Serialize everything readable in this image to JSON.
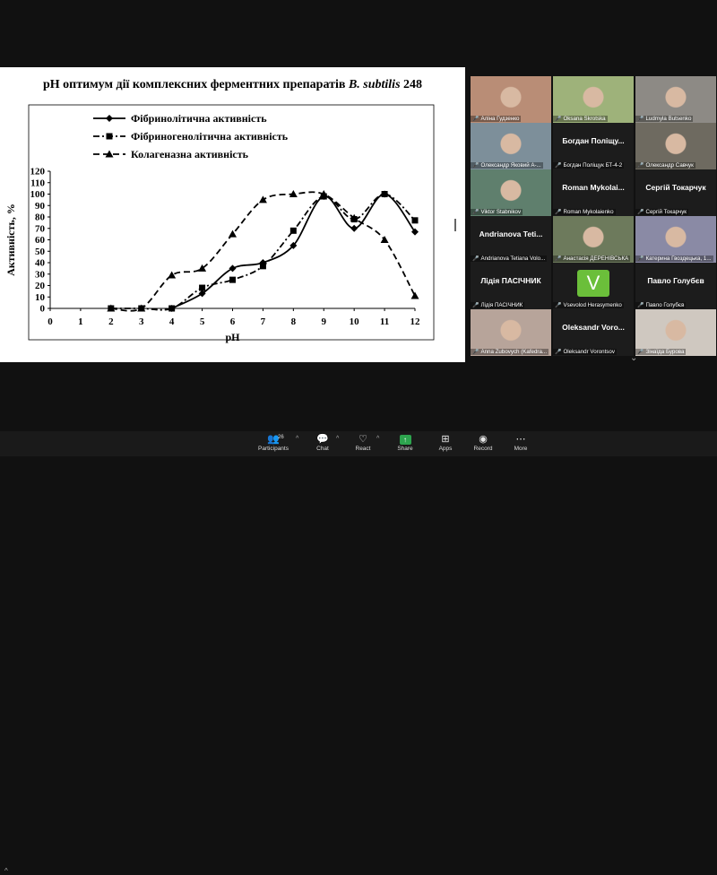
{
  "slide": {
    "title_main": "pH оптимум дії комплексних ферментних препаратів ",
    "title_italic": "B. subtilis",
    "title_tail": " 248"
  },
  "chart_data": {
    "type": "line",
    "xlabel": "pH",
    "ylabel": "Активність, %",
    "xlim": [
      0,
      12
    ],
    "ylim": [
      0,
      120
    ],
    "x_ticks": [
      "0",
      "1",
      "2",
      "3",
      "4",
      "5",
      "6",
      "7",
      "8",
      "9",
      "10",
      "11",
      "12"
    ],
    "y_ticks": [
      "0",
      "10",
      "20",
      "30",
      "40",
      "50",
      "60",
      "70",
      "80",
      "90",
      "100",
      "110",
      "120"
    ],
    "series": [
      {
        "name": "Фібринолітична активність",
        "marker": "diamond",
        "dash": "solid",
        "x": [
          4,
          5,
          6,
          7,
          8,
          9,
          10,
          11,
          12
        ],
        "y": [
          0,
          13,
          35,
          40,
          55,
          98,
          70,
          100,
          67
        ]
      },
      {
        "name": "Фібриногенолітична активність",
        "marker": "square",
        "dash": "dashdot",
        "x": [
          2,
          3,
          4,
          5,
          6,
          7,
          8,
          9,
          10,
          11,
          12
        ],
        "y": [
          0,
          0,
          0,
          18,
          25,
          37,
          68,
          98,
          78,
          100,
          77
        ]
      },
      {
        "name": "Колагеназна активність",
        "marker": "triangle",
        "dash": "dashed",
        "x": [
          2,
          3,
          4,
          5,
          6,
          7,
          8,
          9,
          10,
          11,
          12
        ],
        "y": [
          0,
          0,
          29,
          35,
          65,
          95,
          100,
          100,
          79,
          60,
          11
        ]
      }
    ]
  },
  "gallery": {
    "tiles": [
      {
        "label": "Аліна Гудзенко",
        "name": ""
      },
      {
        "label": "Oksana Skrotska",
        "name": ""
      },
      {
        "label": "Ludmyla Butsenko",
        "name": ""
      },
      {
        "label": "Олександр Яковий А-...",
        "name": ""
      },
      {
        "label": "Богдан Поліщук БТ-4-2",
        "name": "Богдан Поліщу..."
      },
      {
        "label": "Олександр Савчук",
        "name": ""
      },
      {
        "label": "Viktor Stabnikov",
        "name": ""
      },
      {
        "label": "Roman Mykolaienko",
        "name": "Roman Mykolai..."
      },
      {
        "label": "Сергій Токарчук",
        "name": "Сергій Токарчук"
      },
      {
        "label": "Andrianova Tetiana Volo...",
        "name": "Andrianova Teti..."
      },
      {
        "label": "Анастасія ДЕРЕНІВСЬКА",
        "name": ""
      },
      {
        "label": "Катерина Гвоздецька, 1...",
        "name": ""
      },
      {
        "label": "Лідія ПАСІЧНИК",
        "name": "Лідія ПАСІЧНИК"
      },
      {
        "label": "Vsevolod Herasymenko",
        "name": ""
      },
      {
        "label": "Павло Голубєв",
        "name": "Павло Голубєв"
      },
      {
        "label": "Anna Zubovych (Kafedra...",
        "name": ""
      },
      {
        "label": "Oleksandr Vorontsov",
        "name": "Oleksandr Voro..."
      },
      {
        "label": "Зінаїда Бурова",
        "name": ""
      }
    ],
    "avatar_letter": "V"
  },
  "toolbar": {
    "participants_label": "Participants",
    "participants_count": "26",
    "chat_label": "Chat",
    "react_label": "React",
    "share_label": "Share",
    "apps_label": "Apps",
    "record_label": "Record",
    "more_label": "More"
  }
}
